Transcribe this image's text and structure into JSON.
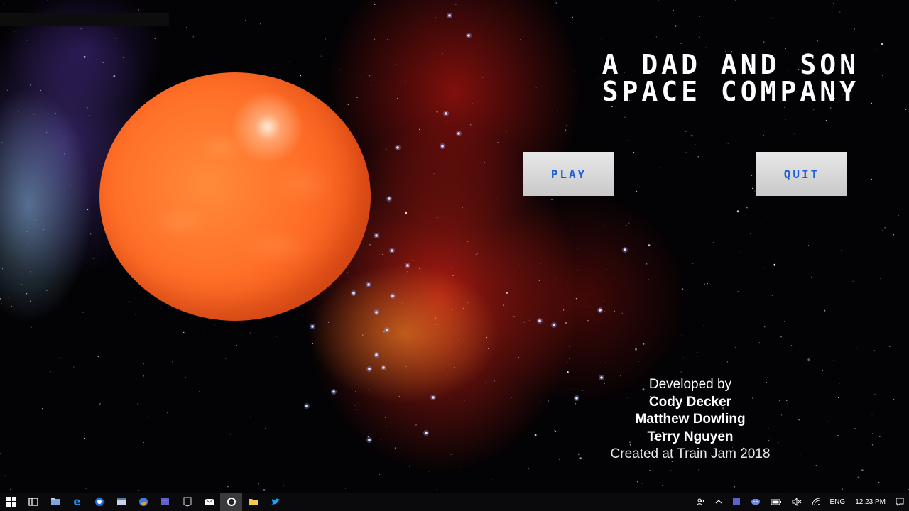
{
  "game": {
    "title_line1": "A DAD AND SON",
    "title_line2": "SPACE COMPANY",
    "play_label": "PLAY",
    "quit_label": "QUIT",
    "credits": {
      "developed_by": "Developed by",
      "developers": [
        "Cody Decker",
        "Matthew Dowling",
        "Terry Nguyen"
      ],
      "created_at": "Created at Train Jam 2018"
    }
  },
  "colors": {
    "button_text": "#1f5fd6",
    "planet": "#ff6f28",
    "background": "#030204"
  },
  "taskbar": {
    "icons": [
      "windows-start-icon",
      "task-view-icon",
      "file-manager-icon",
      "edge-icon",
      "browser-icon",
      "window-icon",
      "firefox-icon",
      "teams-icon",
      "epic-games-icon",
      "mail-icon",
      "unreal-engine-icon",
      "folder-icon",
      "twitter-icon"
    ],
    "tray": {
      "language": "ENG",
      "time": "12:23 PM"
    }
  }
}
